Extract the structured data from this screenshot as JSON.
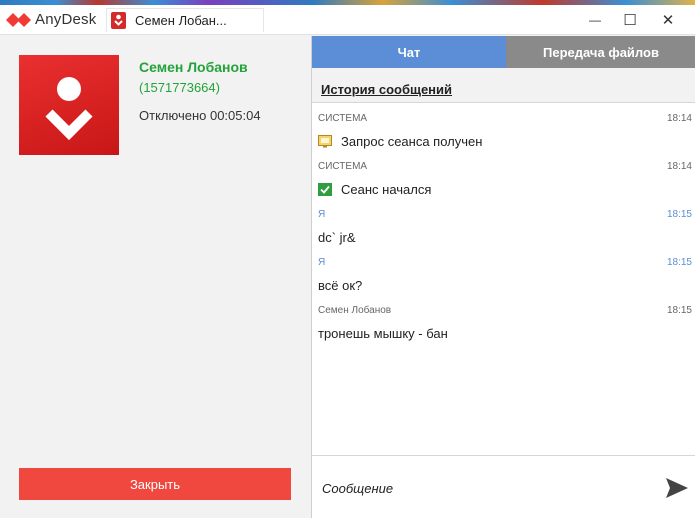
{
  "window": {
    "app_name": "AnyDesk",
    "tab_title": "Семен Лобан...",
    "minimize_glyph": "—",
    "maximize_glyph": "☐",
    "close_glyph": "✕"
  },
  "peer": {
    "name": "Семен Лобанов",
    "id": "(1571773664)",
    "status": "Отключено 00:05:04"
  },
  "left_panel": {
    "close_label": "Закрыть"
  },
  "tabs": {
    "chat": "Чат",
    "files": "Передача файлов"
  },
  "history_label": "История сообщений",
  "messages": [
    {
      "sender": "СИСТЕМА",
      "time": "18:14",
      "text": "Запрос сеанса получен",
      "icon": "session-request-icon"
    },
    {
      "sender": "СИСТЕМА",
      "time": "18:14",
      "text": "Сеанс начался",
      "icon": "session-started-check-icon"
    },
    {
      "sender": "Я",
      "time": "18:15",
      "text": "dc` jr&"
    },
    {
      "sender": "Я",
      "time": "18:15",
      "text": "всё ок?"
    },
    {
      "sender": "Семен Лобанов",
      "time": "18:15",
      "text": "тронешь мышку - бан"
    }
  ],
  "composer": {
    "placeholder": "Сообщение"
  },
  "colors": {
    "accent_red": "#ef3b34",
    "peer_green": "#23a33a",
    "chat_tab_blue": "#5b8ed6",
    "files_tab_gray": "#8a8a8a"
  }
}
